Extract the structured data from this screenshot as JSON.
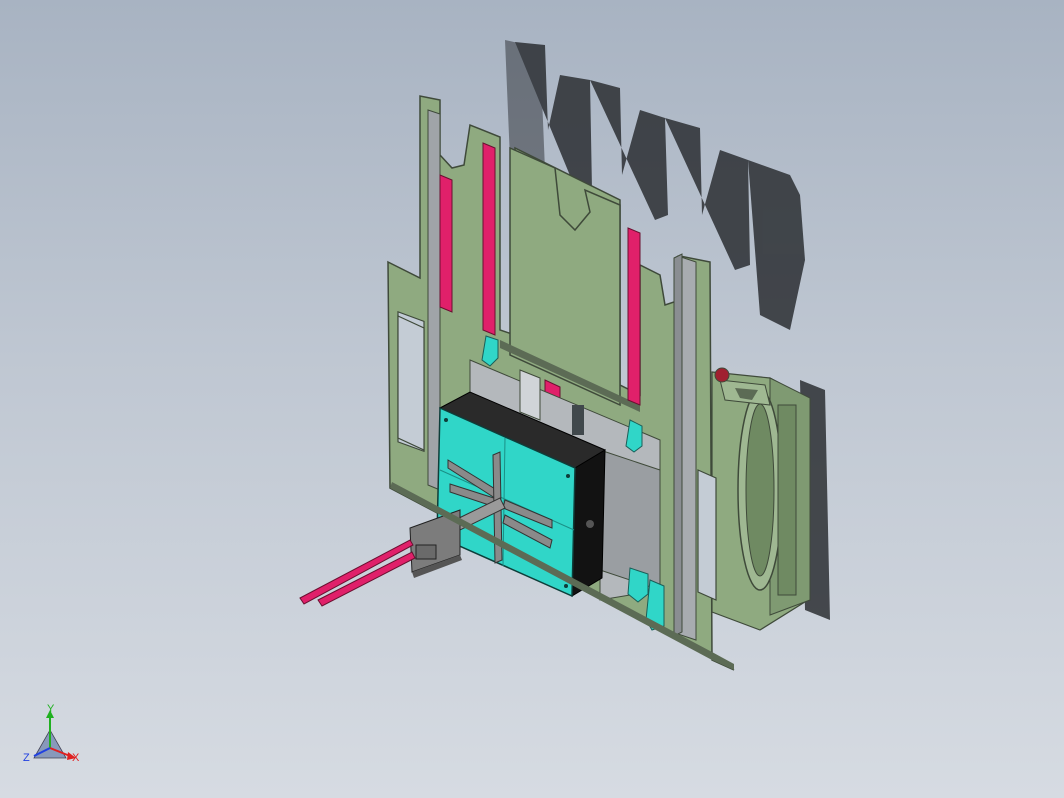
{
  "viewport": {
    "background_top": "#a8b3c2",
    "background_bottom": "#d6dbe2"
  },
  "colors": {
    "frame_green": "#8faa80",
    "frame_edge": "#3f4a3a",
    "rail_magenta": "#e0206a",
    "clamp_cyan": "#30d6c8",
    "block_black": "#121212",
    "arm_gray": "#7c7c7c",
    "shadow": "#2c2f33"
  },
  "triad": {
    "x_label": "X",
    "y_label": "Y",
    "z_label": "Z",
    "x_color": "#e02020",
    "y_color": "#20b020",
    "z_color": "#2040e0"
  }
}
